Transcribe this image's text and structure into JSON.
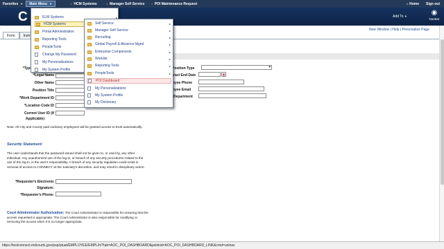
{
  "topbar": {
    "favorites": "Favorites",
    "main_menu": "Main Menu",
    "hcm_systems": "HCM Systems",
    "manager_self_service": "Manager Self Service",
    "poi_maintenance_request": "POI Maintenance Request",
    "home": "Home",
    "sign_out": "Sign out"
  },
  "header": {
    "logo_letter": "C",
    "add_to": "Add To",
    "navbar": "NavBar"
  },
  "tabs": [
    "Form",
    "Instr"
  ],
  "toplinks": {
    "new_window": "New Window",
    "help": "Help",
    "personalize_page": "Personalize Page"
  },
  "form": {
    "type_label": "*Type",
    "legal_name": "*Legal Name",
    "other_name": "Other Name",
    "position_title": "Position Title",
    "work_department_id": "*Work Department ID",
    "location_code_id": "*Location Code ID",
    "current_user_id": "Current User ID (If",
    "applicable": "Applicable)",
    "position_type": "Position Type",
    "contract_end_date": "ract End Date",
    "employee_phone": "oyee Phone",
    "employee_email": "oyee Email",
    "department": "Department",
    "calendar_icon": "calendar-icon"
  },
  "note": "Note: All City and County paid Judiciary employees will be granted access to ELM automatically.",
  "security": {
    "heading": "Security Statement:",
    "body": "The user understands that the password issued shall not be given to, or used by, any other individual. Any unauthorized use of the log-in, or breach of any security procedures related to the use of the log-in, is the user's responsibility. A breach of any security regulation could result in removal of access to CONNECT at the Judiciary's discretion, and may result in disciplinary action.",
    "req_electronic": "*Requester's Electronic",
    "signature": "Signature:",
    "req_phone": "*Requester's Phone:"
  },
  "court_admin": {
    "heading": "Court Administrator Authorization:",
    "body_1": "The Court Administrator is responsible",
    "body_2": "for ensuring that the access requested is appropriate. The Court Administrator is also responsible for modifying or removing the access when it is no longer appropriate."
  },
  "menu1": {
    "close": "x",
    "items": [
      {
        "label": "ELM Systems",
        "type": "folder"
      },
      {
        "label": "HCM Systems",
        "type": "folder",
        "selected": true
      },
      {
        "label": "Portal Administration",
        "type": "folder"
      },
      {
        "label": "Reporting Tools",
        "type": "folder"
      },
      {
        "label": "PeopleTools",
        "type": "folder"
      },
      {
        "label": "Change My Password",
        "type": "page"
      },
      {
        "label": "My Personalizations",
        "type": "page"
      },
      {
        "label": "My System Profile",
        "type": "page"
      }
    ]
  },
  "menu2": {
    "items": [
      {
        "label": "Self Service",
        "type": "folder"
      },
      {
        "label": "Manager Self Service",
        "type": "folder"
      },
      {
        "label": "Recruiting",
        "type": "folder"
      },
      {
        "label": "Global Payroll & Absence Mgmt",
        "type": "folder"
      },
      {
        "label": "Enterprise Components",
        "type": "folder"
      },
      {
        "label": "Worklist",
        "type": "folder"
      },
      {
        "label": "Reporting Tools",
        "type": "folder"
      },
      {
        "label": "PeopleTools",
        "type": "folder"
      },
      {
        "label": "POI Dashboard",
        "type": "page",
        "hover": true
      },
      {
        "label": "My Personalizations",
        "type": "page"
      },
      {
        "label": "My System Profile",
        "type": "page"
      },
      {
        "label": "My Dictionary",
        "type": "page"
      }
    ]
  },
  "status_url": "https://testconnect.mdcourts.gov/psp/ptuat/EMPLOYEE/EMPL/h/?tab=AOC_POI_DASHBOARD&pslnkid=AOC_POI_DASHBOARD_LINK&cmd=uninav",
  "colors": {
    "topbar": "#253a59",
    "header": "#0e2447",
    "link": "#1a4a9a",
    "folder": "#f3c546"
  }
}
